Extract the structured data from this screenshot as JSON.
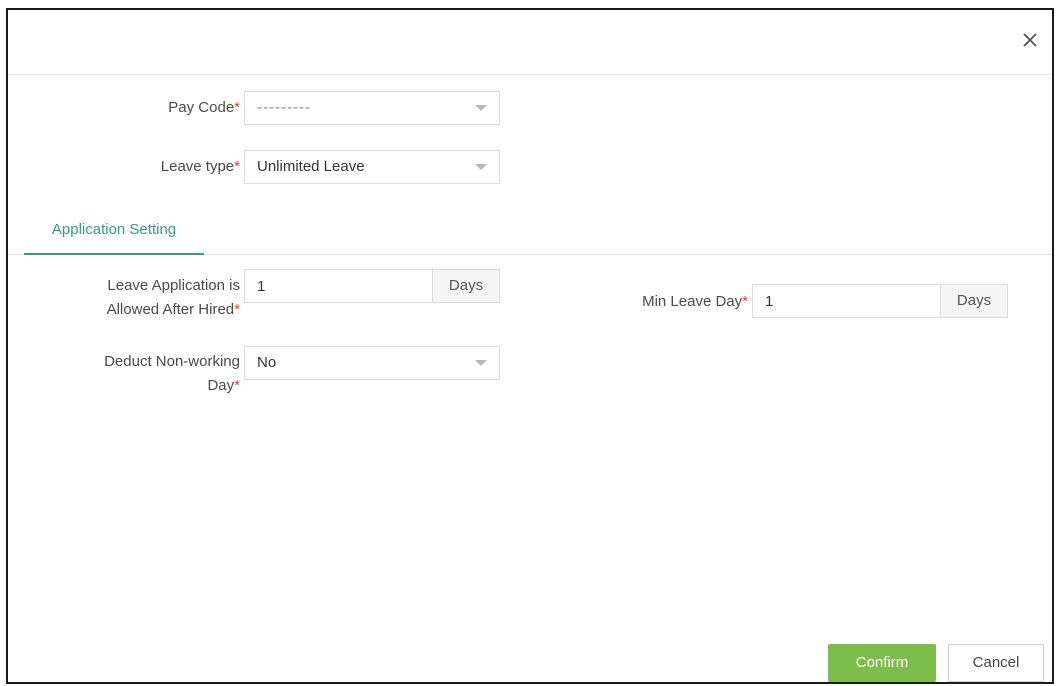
{
  "form": {
    "pay_code": {
      "label": "Pay Code",
      "required_mark": "*",
      "value": "---------"
    },
    "leave_type": {
      "label": "Leave type",
      "required_mark": "*",
      "value": "Unlimited Leave"
    }
  },
  "tabs": [
    {
      "label": "Application Setting",
      "active": true
    }
  ],
  "application_setting": {
    "leave_after_hired": {
      "label_line1": "Leave Application is",
      "label_line2": "Allowed After Hired",
      "required_mark": "*",
      "value": "1",
      "unit": "Days"
    },
    "min_leave_day": {
      "label": "Min Leave Day",
      "required_mark": "*",
      "value": "1",
      "unit": "Days"
    },
    "deduct_non_working_day": {
      "label_line1": "Deduct Non-working",
      "label_line2": "Day",
      "required_mark": "*",
      "value": "No"
    }
  },
  "footer": {
    "confirm_label": "Confirm",
    "cancel_label": "Cancel"
  },
  "colors": {
    "accent": "#3a9a82",
    "confirm": "#7cbd4c",
    "required": "#e04040"
  },
  "icons": {
    "close": "close-icon",
    "dropdown": "chevron-down-icon"
  }
}
